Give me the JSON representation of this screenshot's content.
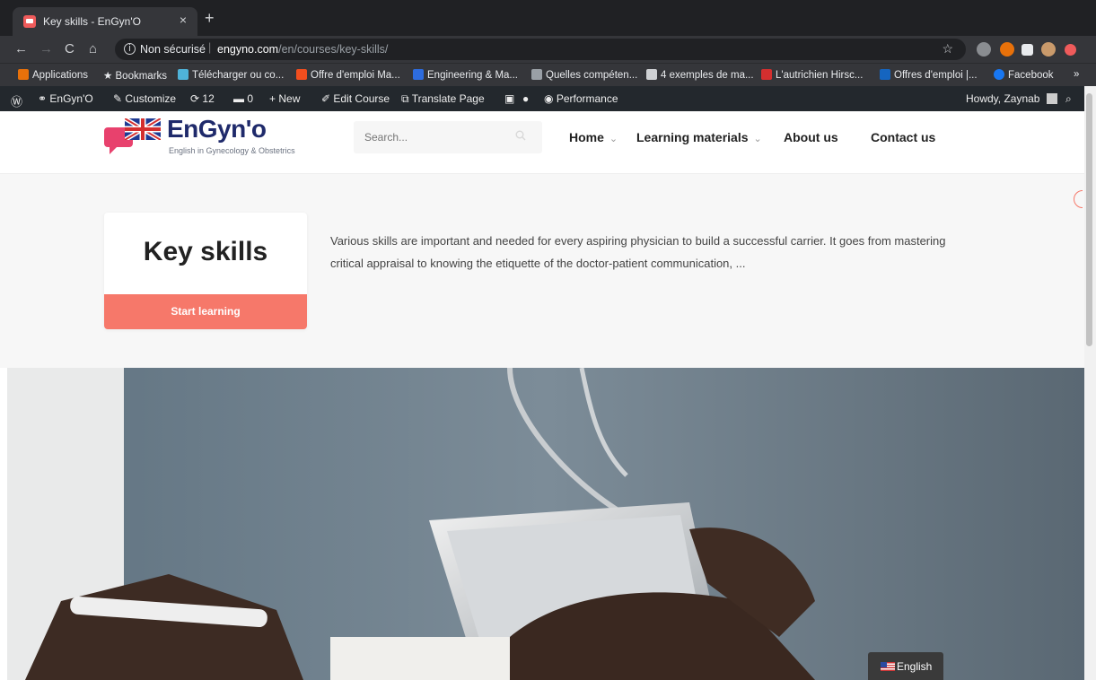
{
  "browser": {
    "tab_title": "Key skills - EnGyn'O",
    "tab_close": "×",
    "new_tab": "+",
    "security_label": "Non sécurisé",
    "url_host": "engyno.com",
    "url_path": "/en/courses/key-skills/"
  },
  "bookmarks": [
    {
      "label": "Applications",
      "color": "#e8710a"
    },
    {
      "label": "Bookmarks",
      "color": "#ffffff"
    },
    {
      "label": "Télécharger ou co...",
      "color": "#4fb3d9"
    },
    {
      "label": "Offre d'emploi Ma...",
      "color": "#f24e1e"
    },
    {
      "label": "Engineering & Ma...",
      "color": "#2d6cdf"
    },
    {
      "label": "Quelles compéten...",
      "color": "#9aa0a6"
    },
    {
      "label": "4 exemples de ma...",
      "color": "#cfd1d4"
    },
    {
      "label": "L'autrichien Hirsc...",
      "color": "#d32f2f"
    },
    {
      "label": "Offres d'emploi |...",
      "color": "#1565c0"
    },
    {
      "label": "Facebook",
      "color": "#1877f2"
    }
  ],
  "bookmarks_more": "»",
  "wpbar": {
    "site": "EnGyn'O",
    "customize": "Customize",
    "updates": "12",
    "comments": "0",
    "new": "New",
    "edit_course": "Edit Course",
    "translate": "Translate Page",
    "performance": "Performance",
    "howdy": "Howdy, Zaynab"
  },
  "site": {
    "logo_text": "EnGyn'o",
    "logo_sub": "English in Gynecology & Obstetrics",
    "search_placeholder": "Search...",
    "nav": [
      {
        "label": "Home",
        "dropdown": true
      },
      {
        "label": "Learning materials",
        "dropdown": true
      },
      {
        "label": "About us",
        "dropdown": false
      },
      {
        "label": "Contact us",
        "dropdown": false
      }
    ]
  },
  "course": {
    "title": "Key skills",
    "cta": "Start learning",
    "description": "Various skills are important and needed for every aspiring physician to build a successful carrier. It goes from mastering critical appraisal to knowing the etiquette of the doctor-patient communication, ..."
  },
  "language_switcher": "English",
  "colors": {
    "accent": "#f6786a",
    "logo_blue": "#1f2a6b",
    "logo_pink": "#e8416d",
    "wp_bar": "#23282d"
  }
}
